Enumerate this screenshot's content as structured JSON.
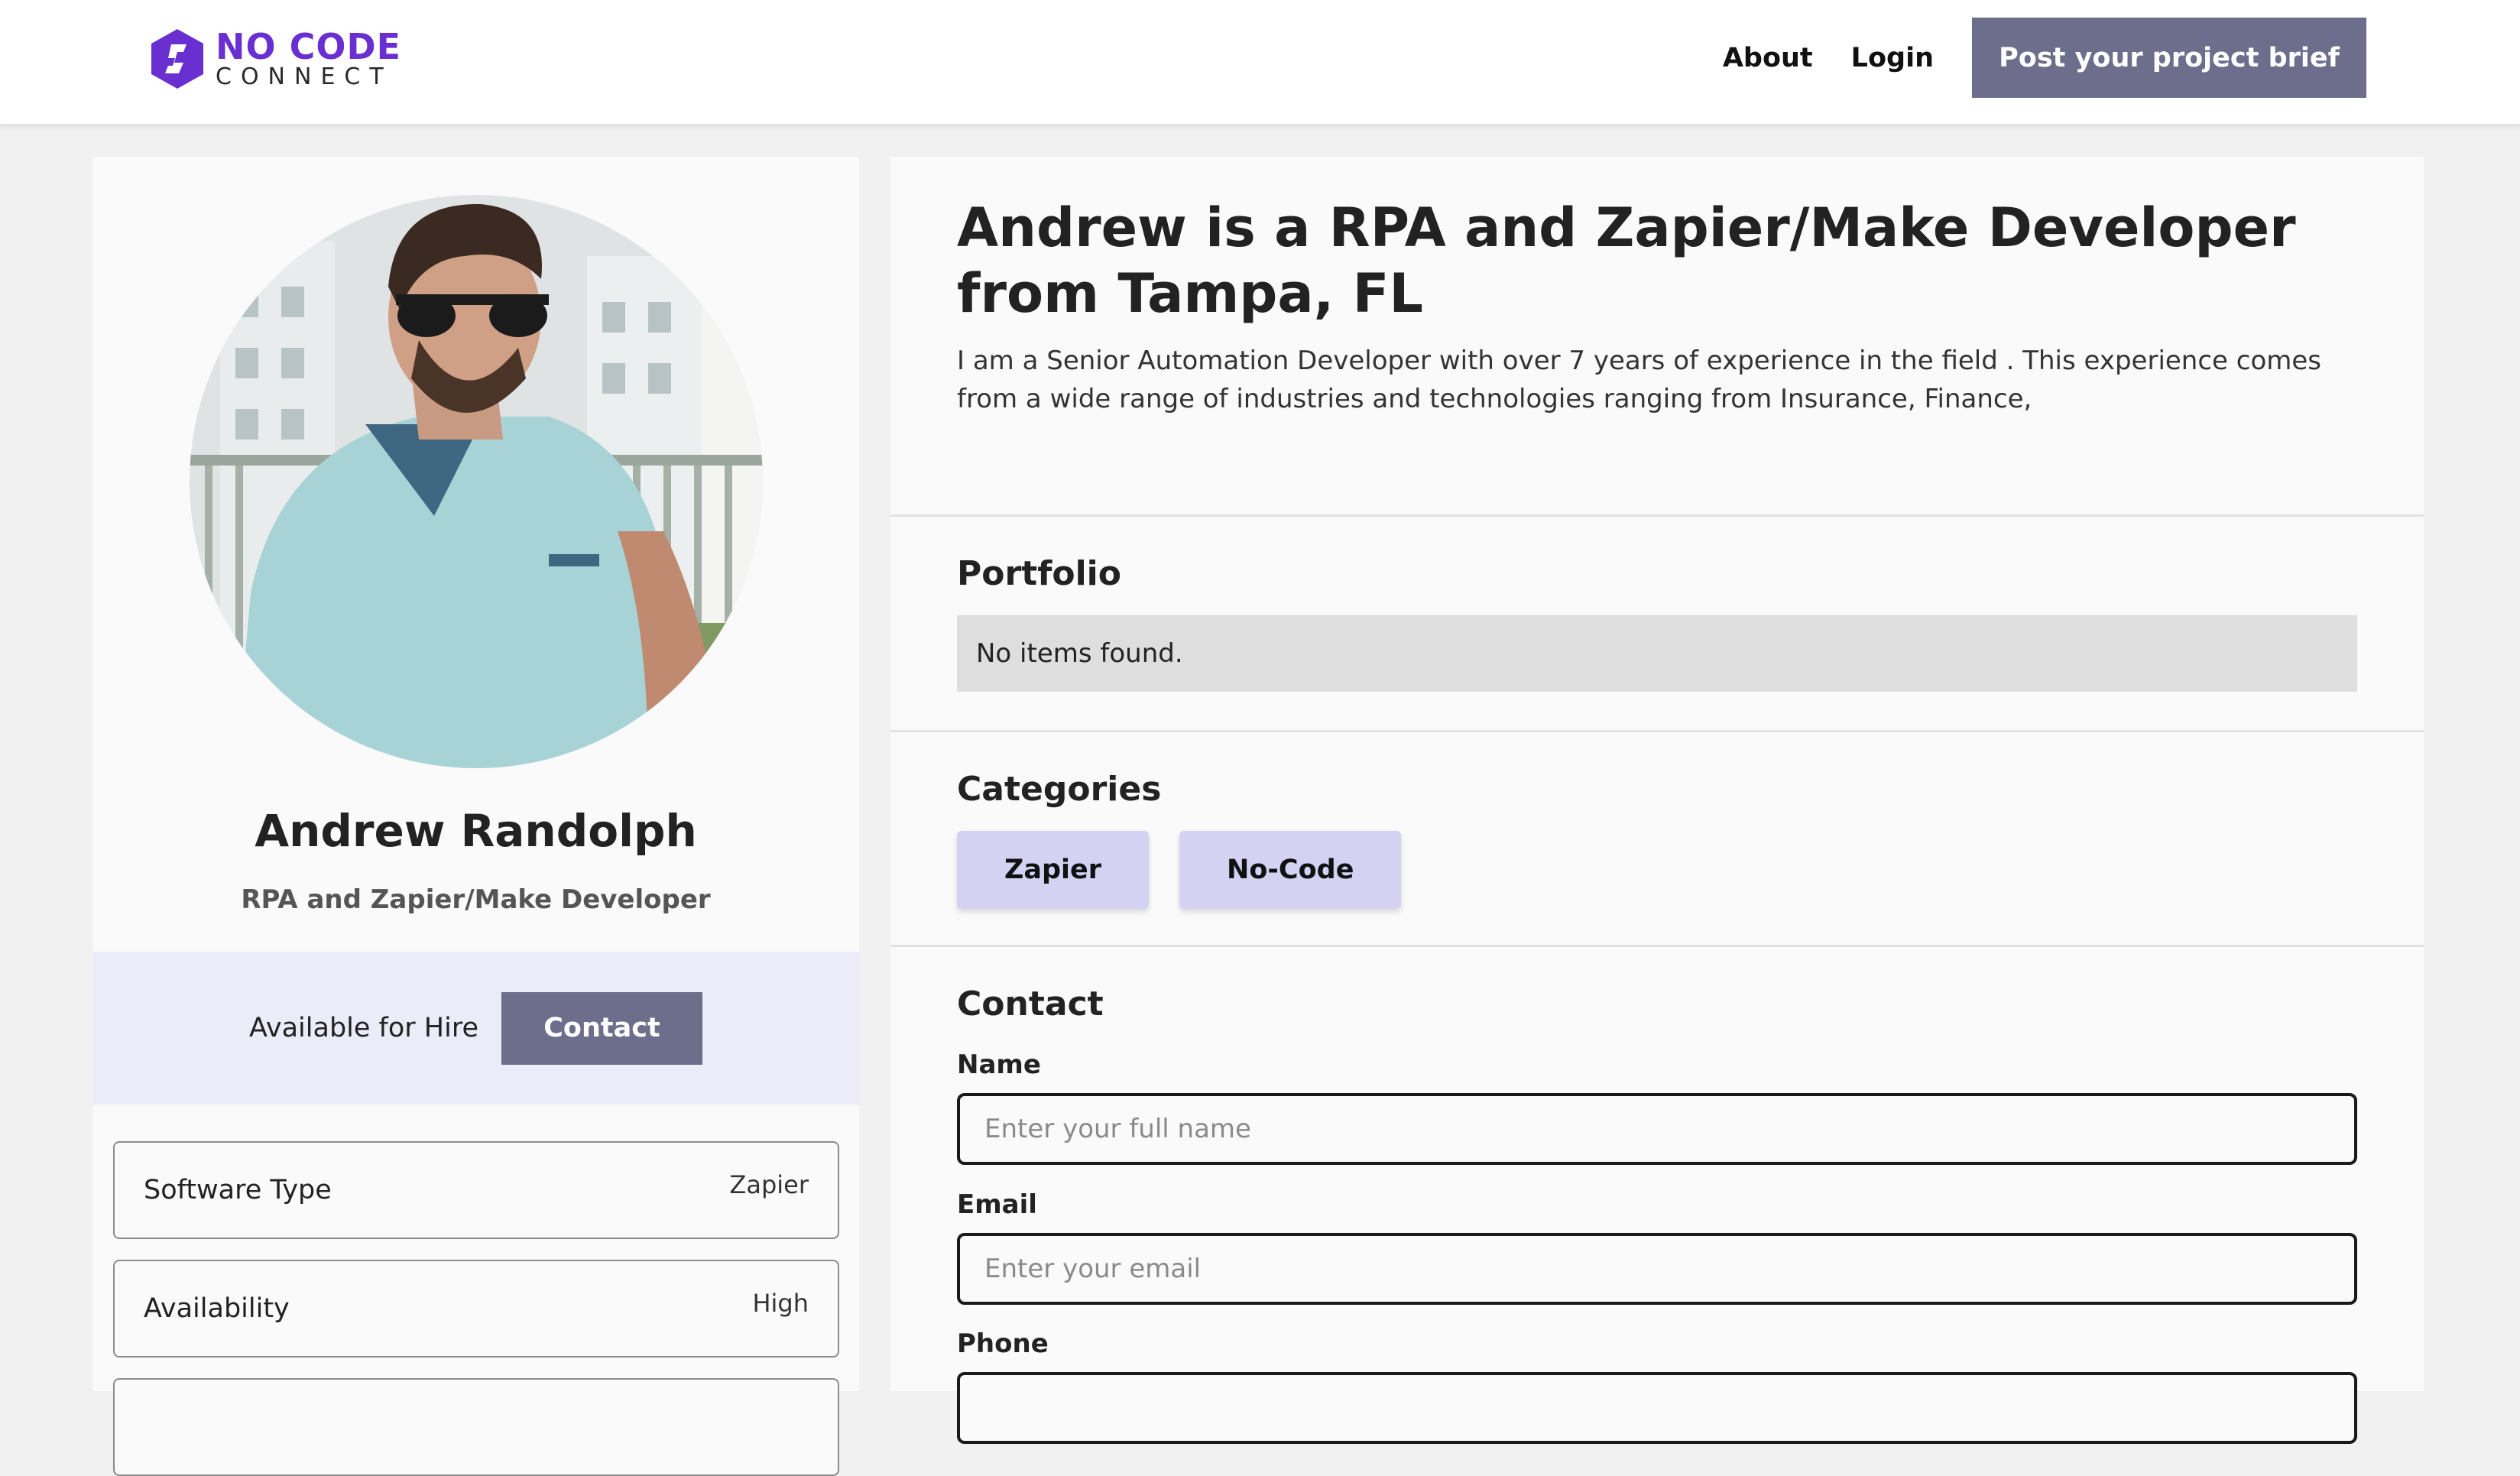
{
  "header": {
    "logo_line1": "NO CODE",
    "logo_line2": "CONNECT",
    "nav_about": "About",
    "nav_login": "Login",
    "cta": "Post your project brief"
  },
  "profile": {
    "name": "Andrew Randolph",
    "title": "RPA and Zapier/Make Developer",
    "availability_text": "Available for Hire",
    "contact_button": "Contact",
    "details": [
      {
        "label": "Software Type",
        "value": "Zapier"
      },
      {
        "label": "Availability",
        "value": "High"
      }
    ]
  },
  "main": {
    "headline": "Andrew is a RPA and Zapier/Make Developer from Tampa, FL",
    "bio": "I am a Senior Automation Developer with over 7 years of experience in the field . This experience comes from a wide range of industries and technologies ranging from Insurance, Finance,",
    "portfolio": {
      "title": "Portfolio",
      "empty_text": "No items found."
    },
    "categories": {
      "title": "Categories",
      "items": [
        "Zapier",
        "No-Code"
      ]
    },
    "contact_form": {
      "title": "Contact",
      "name_label": "Name",
      "name_placeholder": "Enter your full name",
      "email_label": "Email",
      "email_placeholder": "Enter your email",
      "phone_label": "Phone"
    }
  },
  "colors": {
    "brand": "#6a2fd1",
    "button": "#6d6e8b",
    "chip": "#d4d2f3",
    "hire_bar": "#ecebf8"
  }
}
